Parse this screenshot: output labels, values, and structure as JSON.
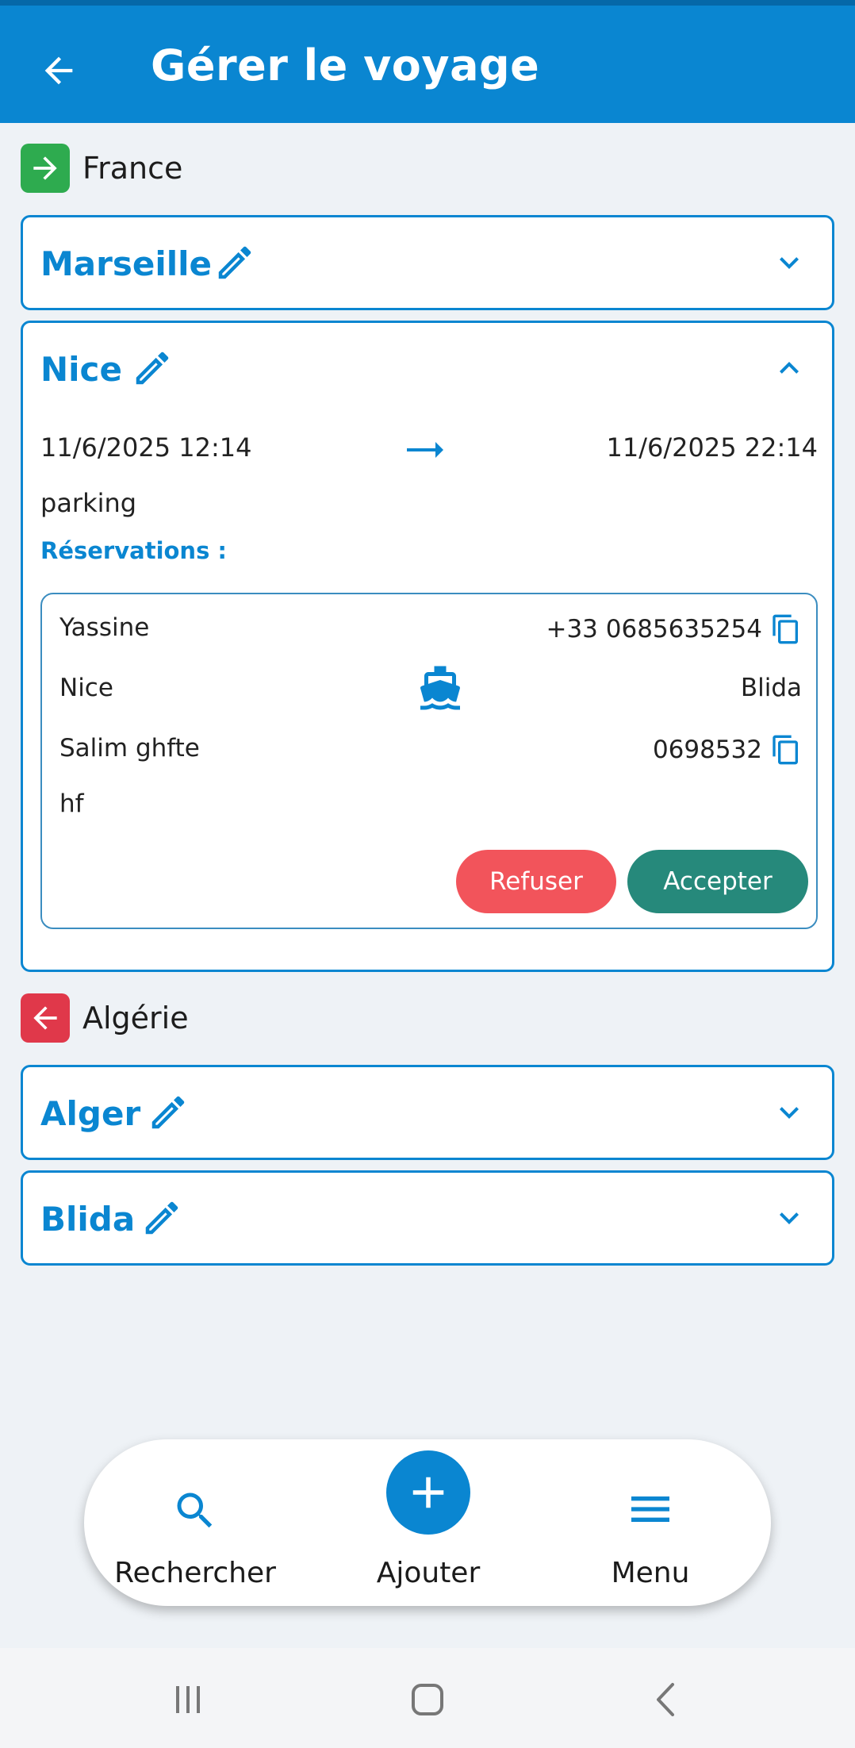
{
  "appbar": {
    "title": "Gérer le voyage",
    "back_icon": "arrow-left-icon"
  },
  "colors": {
    "primary": "#0a86d1",
    "outbound_badge": "#2eab4f",
    "return_badge": "#e0384a",
    "refuse": "#f2545b",
    "accept": "#26897b"
  },
  "outbound": {
    "country": "France",
    "badge_icon": "arrow-right-icon",
    "stops": [
      {
        "city": "Marseille",
        "expanded": false
      },
      {
        "city": "Nice",
        "expanded": true,
        "departure": "11/6/2025 12:14",
        "arrival": "11/6/2025 22:14",
        "note": "parking",
        "reservations_label": "Réservations :",
        "reservation": {
          "sender_name": "Yassine",
          "sender_phone": "+33 0685635254",
          "from": "Nice",
          "transport_icon": "ship-icon",
          "to": "Blida",
          "receiver_name": "Salim ghfte",
          "receiver_phone": "0698532",
          "comment": "hf",
          "refuse_label": "Refuser",
          "accept_label": "Accepter"
        }
      }
    ]
  },
  "return": {
    "country": "Algérie",
    "badge_icon": "arrow-left-icon",
    "stops": [
      {
        "city": "Alger",
        "expanded": false
      },
      {
        "city": "Blida",
        "expanded": false
      }
    ]
  },
  "bottom_nav": {
    "search_label": "Rechercher",
    "add_label": "Ajouter",
    "menu_label": "Menu"
  }
}
